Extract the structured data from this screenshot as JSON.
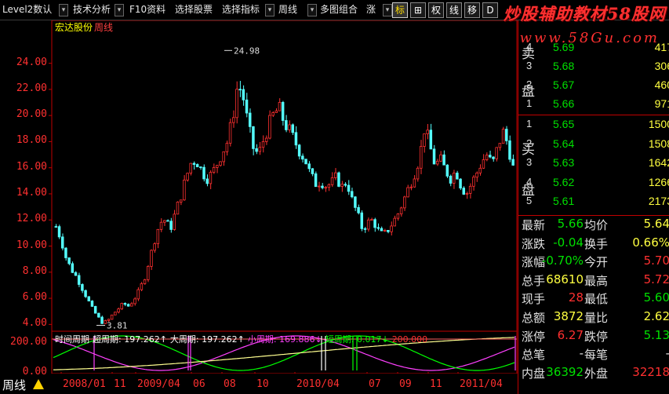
{
  "toolbar": {
    "items": [
      "Level2数认",
      "技术分析",
      "F10资料",
      "选择股票",
      "选择指标",
      "周线",
      "多图组合",
      "涨"
    ],
    "squares": [
      "标",
      "⊞",
      "权",
      "线",
      "移",
      "D"
    ]
  },
  "brand": {
    "text": "炒股辅助教材58股网",
    "site": "www.58Gu.com"
  },
  "stock": {
    "name": "宏达股份",
    "period": "周线"
  },
  "annotations": {
    "high": "24.98",
    "low": "3.81"
  },
  "indicator": {
    "header": [
      {
        "text": "时间周期",
        "color": "#ffffff"
      },
      {
        "text": "超周期: 197.262↑",
        "color": "#ffffff"
      },
      {
        "text": "大周期: 197.262↑",
        "color": "#ffffff"
      },
      {
        "text": "小周期: 169.886↓",
        "color": "#ff40ff"
      },
      {
        "text": "短周期: 0.017↓",
        "color": "#00ff00"
      },
      {
        "text": "200.000",
        "color": "#ff3030"
      }
    ],
    "ylabels": [
      "200.00",
      "0.00"
    ]
  },
  "period_tab": "周线",
  "order_book": {
    "sell_label": [
      "卖",
      "盘"
    ],
    "buy_label": [
      "买",
      "盘"
    ],
    "sell": [
      {
        "level": "4",
        "price": "5.69",
        "vol": "417"
      },
      {
        "level": "3",
        "price": "5.68",
        "vol": "306"
      },
      {
        "level": "2",
        "price": "5.67",
        "vol": "460"
      },
      {
        "level": "1",
        "price": "5.66",
        "vol": "971"
      }
    ],
    "buy": [
      {
        "level": "1",
        "price": "5.65",
        "vol": "1500"
      },
      {
        "level": "2",
        "price": "5.64",
        "vol": "1508"
      },
      {
        "level": "3",
        "price": "5.63",
        "vol": "1642"
      },
      {
        "level": "4",
        "price": "5.62",
        "vol": "1266"
      },
      {
        "level": "5",
        "price": "5.61",
        "vol": "2173"
      }
    ]
  },
  "quote": [
    {
      "k1": "最新",
      "v1": "5.66",
      "c1": "#00e000",
      "k2": "均价",
      "v2": "5.64",
      "c2": "#ffff40"
    },
    {
      "k1": "涨跌",
      "v1": "-0.04",
      "c1": "#00e000",
      "k2": "换手",
      "v2": "0.66%",
      "c2": "#ffff40"
    },
    {
      "k1": "涨幅",
      "v1": "-0.70%",
      "c1": "#00e000",
      "k2": "今开",
      "v2": "5.70",
      "c2": "#ff3030"
    },
    {
      "k1": "总手",
      "v1": "68610",
      "c1": "#ffff40",
      "k2": "最高",
      "v2": "5.72",
      "c2": "#ff3030"
    },
    {
      "k1": "现手",
      "v1": "28",
      "c1": "#ff3030",
      "k2": "最低",
      "v2": "5.60",
      "c2": "#00e000"
    },
    {
      "k1": "总额",
      "v1": "3872",
      "c1": "#ffff40",
      "k2": "量比",
      "v2": "2.62",
      "c2": "#ffff40"
    },
    {
      "k1": "涨停",
      "v1": "6.27",
      "c1": "#ff3030",
      "k2": "跌停",
      "v2": "5.13",
      "c2": "#00e000"
    },
    {
      "k1": "总笔",
      "v1": "-",
      "c1": "#e0e0e0",
      "k2": "每笔",
      "v2": "-",
      "c2": "#e0e0e0"
    },
    {
      "k1": "内盘",
      "v1": "36392",
      "c1": "#00e000",
      "k2": "外盘",
      "v2": "32218",
      "c2": "#ff3030"
    }
  ],
  "chart_data": {
    "type": "candlestick",
    "ylim": [
      3.6,
      25.6
    ],
    "yticks": [
      "24.00",
      "22.00",
      "20.00",
      "18.00",
      "16.00",
      "14.00",
      "12.00",
      "10.00",
      "8.00",
      "6.00",
      "4.00"
    ],
    "xticks": [
      "2008/01",
      "11",
      "2009/04",
      "06",
      "08",
      "10",
      "2010/04",
      "07",
      "09",
      "11",
      "2011/04"
    ],
    "close_path": [
      11.5,
      10.5,
      9.0,
      8.2,
      7.6,
      6.8,
      6.0,
      5.2,
      4.6,
      4.1,
      4.3,
      4.8,
      5.2,
      5.6,
      5.4,
      5.9,
      6.6,
      7.5,
      9.0,
      10.5,
      11.8,
      12.0,
      11.3,
      12.6,
      13.8,
      15.2,
      16.4,
      16.6,
      15.8,
      15.2,
      15.5,
      16.3,
      17.2,
      18.0,
      19.8,
      22.5,
      21.5,
      19.2,
      17.5,
      17.0,
      18.2,
      19.3,
      20.2,
      20.5,
      19.4,
      18.8,
      18.0,
      17.2,
      16.6,
      15.4,
      14.8,
      15.0,
      14.6,
      14.8,
      15.3,
      14.5,
      15.0,
      13.5,
      12.5,
      11.3,
      11.8,
      12.0,
      11.2,
      10.8,
      11.3,
      11.9,
      12.6,
      13.6,
      14.6,
      15.6,
      16.8,
      19.2,
      17.6,
      16.2,
      16.6,
      15.8,
      15.2,
      15.8,
      14.6,
      14.0,
      14.8,
      15.6,
      16.5,
      17.0,
      16.2,
      17.5,
      18.8,
      17.8,
      16.0
    ]
  }
}
